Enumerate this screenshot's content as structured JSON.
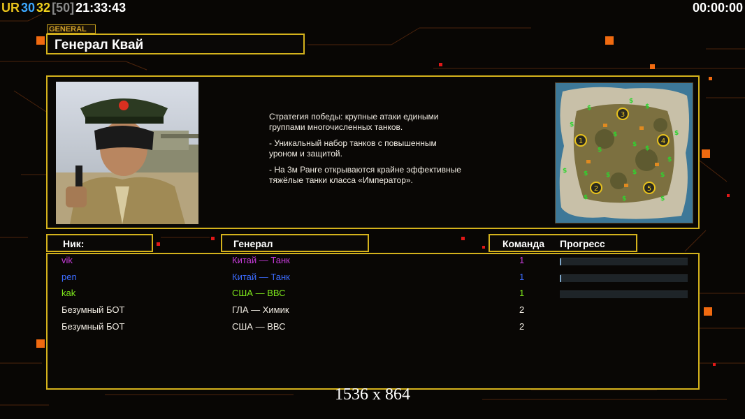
{
  "hud": {
    "ur_label": "UR",
    "val1": "30",
    "val2": "32",
    "val3": "[50]",
    "clock": "21:33:43",
    "timer": "00:00:00"
  },
  "general_tag": "GENERAL",
  "general_name": "Генерал Квай",
  "description": [
    "Стратегия победы: крупные атаки едиными\n группами многочисленных танков.",
    "- Уникальный набор танков с повышенным\n уроном и защитой.",
    "- На 3м Ранге открываются крайне эффективные\n тяжёлые танки класса «Император»."
  ],
  "minimap": {
    "start_positions": [
      "1",
      "2",
      "3",
      "4",
      "5"
    ]
  },
  "table": {
    "headers": {
      "nick": "Ник:",
      "general": "Генерал",
      "team": "Команда",
      "progress": "Прогресс"
    },
    "rows": [
      {
        "nick": "vik",
        "general": "Китай — Танк",
        "team": "1",
        "color": "#c83cdc",
        "progress": 0.01
      },
      {
        "nick": "pen",
        "general": "Китай — Танк",
        "team": "1",
        "color": "#3c6cff",
        "progress": 0.01
      },
      {
        "nick": "kak",
        "general": "США — ВВС",
        "team": "1",
        "color": "#7ee81c",
        "progress": 0
      },
      {
        "nick": "Безумный БОТ",
        "general": "ГЛА — Химик",
        "team": "2",
        "color": "#f2ede4"
      },
      {
        "nick": "Безумный БОТ",
        "general": "США — ВВС",
        "team": "2",
        "color": "#f2ede4"
      }
    ]
  },
  "resolution": "1536 x 864",
  "colors": {
    "frame": "#d4b21c",
    "ur": "#e8c21c",
    "val1": "#3ca8ff",
    "val2": "#f0d21c",
    "val3": "#8a8a8a"
  }
}
